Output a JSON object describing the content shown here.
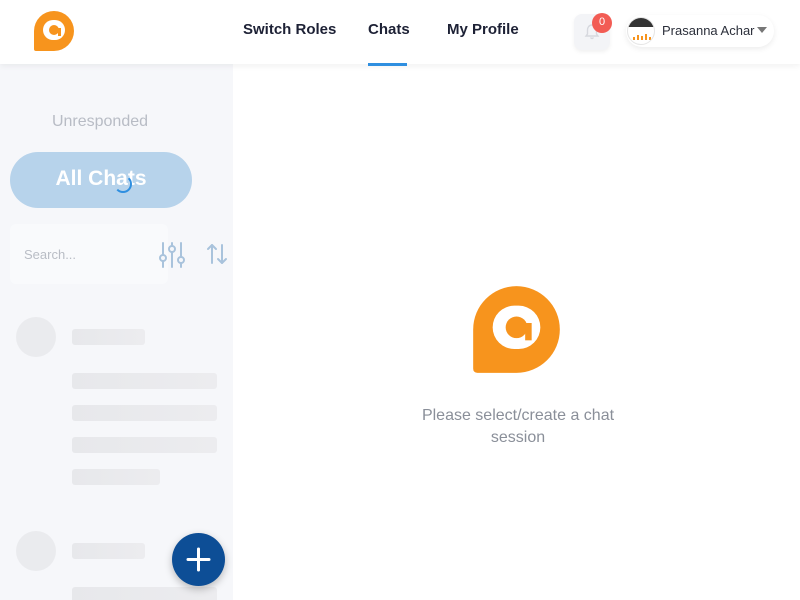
{
  "header": {
    "nav": {
      "switch_roles": "Switch Roles",
      "chats": "Chats",
      "my_profile": "My Profile"
    },
    "active_tab": "Chats",
    "notifications": {
      "count": "0",
      "icon": "bell-icon"
    },
    "user": {
      "name": "Prasanna Achar",
      "dropdown_icon": "caret-down-icon"
    }
  },
  "sidebar": {
    "filter_label": "Unresponded",
    "primary_button": "All Chats",
    "search": {
      "placeholder": "Search...",
      "value": ""
    },
    "icons": {
      "filter": "sliders-icon",
      "sort": "sort-arrows-icon",
      "new_chat": "plus-icon"
    }
  },
  "main": {
    "empty_message": "Please select/create a chat session"
  },
  "colors": {
    "brand_orange": "#f7941d",
    "accent_blue": "#2f8fe0",
    "fab_blue": "#0d4e96",
    "badge_red": "#f25c54",
    "all_chats_bg": "#b7d3eb"
  }
}
